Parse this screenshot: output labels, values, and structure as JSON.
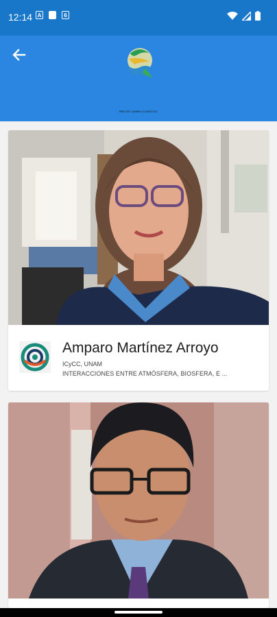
{
  "status_bar": {
    "time": "12:14",
    "left_icons": [
      "notification-a-icon",
      "sd-card-icon",
      "sync-icon"
    ],
    "right_icons": [
      "wifi-icon",
      "signal-icon",
      "battery-icon"
    ]
  },
  "app_bar": {
    "back_icon": "arrow-left-icon",
    "logo_caption": "RED DE CAMBIO CLIMÁTICO"
  },
  "researchers": [
    {
      "name": "Amparo Martínez Arroyo",
      "affiliation": "ICyCC, UNAM",
      "research_area": "INTERACCIONES ENTRE ATMÓSFERA, BIOSFERA, E ..."
    },
    {
      "name": "",
      "affiliation": "",
      "research_area": ""
    }
  ],
  "colors": {
    "status_bar": "#1877c8",
    "app_bar": "#2a86e0",
    "background": "#f2f2f2"
  }
}
